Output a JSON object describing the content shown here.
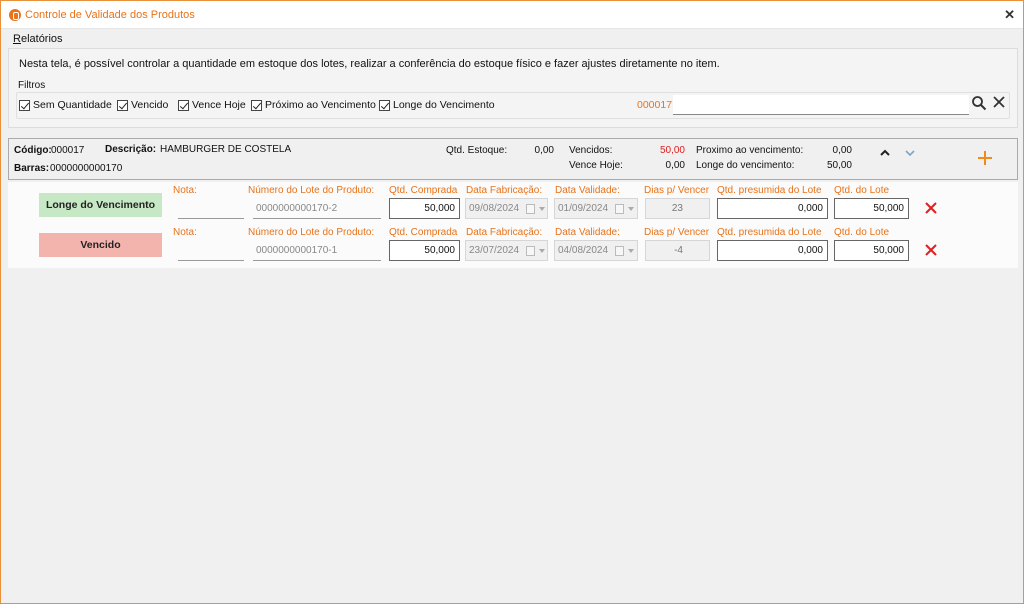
{
  "window": {
    "title": "Controle de Validade dos Produtos",
    "close_glyph": "✕"
  },
  "menu": {
    "relatorios": "Relatórios"
  },
  "info": "Nesta tela, é possível controlar a quantidade em estoque dos lotes, realizar a conferência do estoque físico e fazer ajustes diretamente no item.",
  "filters": {
    "legend": "Filtros",
    "items": [
      {
        "label": "Sem Quantidade",
        "checked": true
      },
      {
        "label": "Vencido",
        "checked": true
      },
      {
        "label": "Vence Hoje",
        "checked": true
      },
      {
        "label": "Próximo ao Vencimento",
        "checked": true
      },
      {
        "label": "Longe do Vencimento",
        "checked": true
      }
    ],
    "code": "000017",
    "search_value": "",
    "icons": {
      "search": "search-icon",
      "clear": "close-icon"
    }
  },
  "product": {
    "codigo_label": "Código:",
    "codigo": "000017",
    "descricao_label": "Descrição:",
    "descricao": "HAMBURGER DE COSTELA",
    "barras_label": "Barras:",
    "barras": "0000000000170",
    "qtd_estoque_label": "Qtd. Estoque:",
    "qtd_estoque": "0,00",
    "vencidos_label": "Vencidos:",
    "vencidos": "50,00",
    "vence_hoje_label": "Vence Hoje:",
    "vence_hoje": "0,00",
    "proximo_label": "Proximo ao vencimento:",
    "proximo": "0,00",
    "longe_label": "Longe do vencimento:",
    "longe": "50,00",
    "icons": {
      "up": "chevron-up-icon",
      "down": "chevron-down-icon",
      "add": "plus-icon"
    }
  },
  "lot_labels": {
    "nota": "Nota:",
    "numero_lote": "Número do Lote do Produto:",
    "qtd_comprada": "Qtd. Comprada",
    "data_fabricacao": "Data Fabricação:",
    "data_validade": "Data Validade:",
    "dias_vencer": "Dias p/ Vencer",
    "qtd_presumida": "Qtd. presumida do Lote",
    "qtd_lote": "Qtd. do Lote"
  },
  "lots": [
    {
      "status": "Longe do Vencimento",
      "status_color": "#c6e8c4",
      "nota": "",
      "numero_lote": "0000000000170-2",
      "qtd_comprada": "50,000",
      "data_fabricacao": "09/08/2024",
      "data_validade": "01/09/2024",
      "dias_vencer": "23",
      "qtd_presumida": "0,000",
      "qtd_lote": "50,000"
    },
    {
      "status": "Vencido",
      "status_color": "#f4b4ae",
      "nota": "",
      "numero_lote": "0000000000170-1",
      "qtd_comprada": "50,000",
      "data_fabricacao": "23/07/2024",
      "data_validade": "04/08/2024",
      "dias_vencer": "-4",
      "qtd_presumida": "0,000",
      "qtd_lote": "50,000"
    }
  ],
  "colors": {
    "accent": "#e8731a",
    "danger": "#e02020",
    "plus": "#f08a1a"
  }
}
